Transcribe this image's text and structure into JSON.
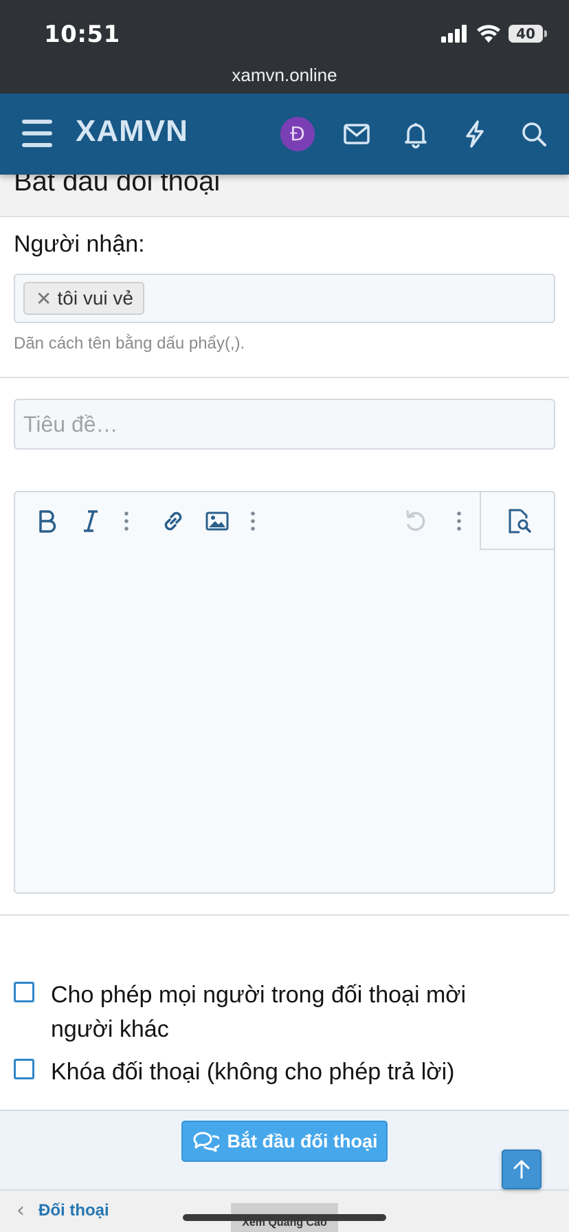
{
  "status_bar": {
    "time": "10:51",
    "battery": "40"
  },
  "browser": {
    "url": "xamvn.online"
  },
  "header": {
    "brand": "XAMVN",
    "avatar_letter": "Đ",
    "icons": [
      "menu-icon",
      "mail-icon",
      "bell-icon",
      "bolt-icon",
      "search-icon"
    ],
    "bg_color": "#185886"
  },
  "page": {
    "title": "Bắt đầu đối thoại"
  },
  "recipient": {
    "label": "Người nhận:",
    "tokens": [
      "tôi vui vẻ"
    ],
    "remove_glyph": "✕",
    "hint": "Dãn cách tên bằng dấu phẩy(,)."
  },
  "title_field": {
    "placeholder": "Tiêu đề…",
    "value": ""
  },
  "editor": {
    "toolbar": [
      "bold-icon",
      "italic-icon",
      "more-icon",
      "link-icon",
      "image-icon",
      "more-icon",
      "undo-icon",
      "more-icon",
      "preview-icon"
    ],
    "value": ""
  },
  "options": [
    {
      "label": "Cho phép mọi người trong đối thoại mời người khác",
      "checked": false
    },
    {
      "label": "Khóa đối thoại (không cho phép trả lời)",
      "checked": false
    }
  ],
  "submit": {
    "label": "Bắt đầu đối thoại",
    "color": "#47a7eb"
  },
  "footer": {
    "breadcrumb": "Đối thoại",
    "ad_label": "Xem Quảng Cáo"
  }
}
